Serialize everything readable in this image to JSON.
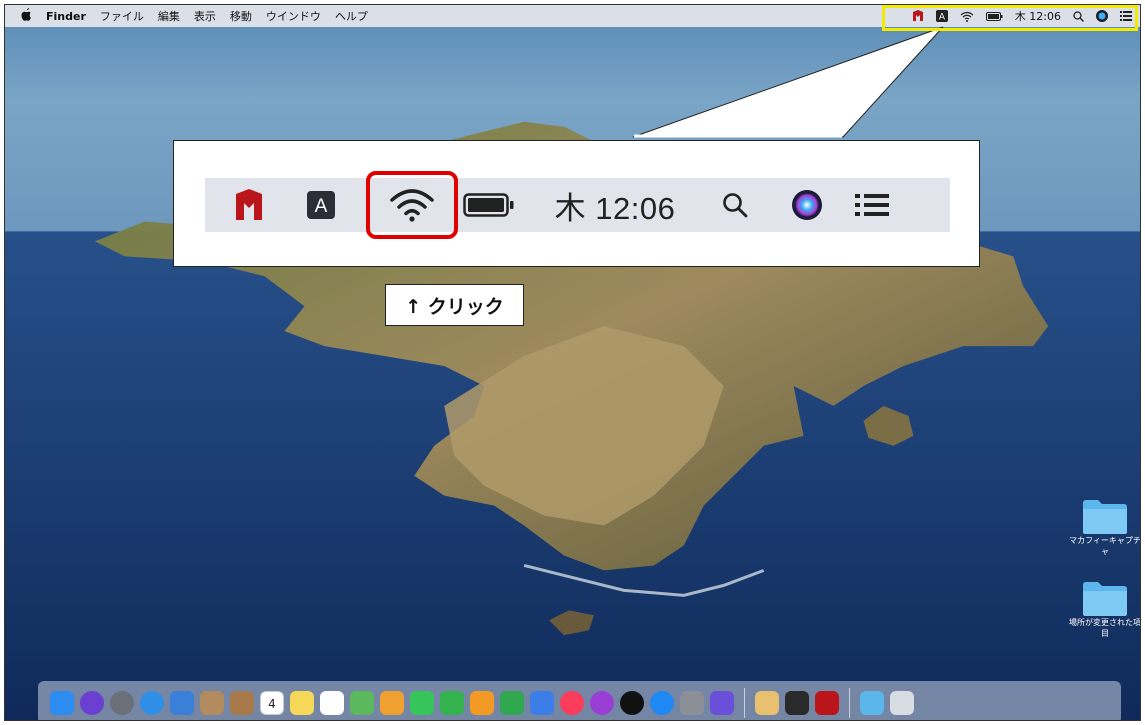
{
  "menubar": {
    "apple_glyph": "",
    "items": [
      "Finder",
      "ファイル",
      "編集",
      "表示",
      "移動",
      "ウインドウ",
      "ヘルプ"
    ],
    "status": {
      "clock": "木 12:06"
    }
  },
  "callout": {
    "clock": "木 12:06",
    "ime_letter": "A"
  },
  "click_label": "↑ クリック",
  "desktop": {
    "folders": [
      {
        "label": "マカフィーキャプチャ"
      },
      {
        "label": "場所が変更された項目"
      }
    ]
  },
  "dock": {
    "items": [
      "finder-icon",
      "siri-icon",
      "launchpad-icon",
      "safari-icon",
      "mail-icon",
      "contacts-icon",
      "notes-book-icon",
      "calendar-icon",
      "notes-icon",
      "reminders-icon",
      "maps-icon",
      "photos-icon",
      "messages-icon",
      "facetime-icon",
      "pages-icon",
      "numbers-icon",
      "keynote-icon",
      "music-icon",
      "podcasts-icon",
      "appletv-icon",
      "appstore-icon",
      "system-preferences-icon",
      "imovie-icon",
      "preview-icon",
      "quicktime-icon",
      "mcafee-icon",
      "downloads-folder-icon",
      "trash-icon"
    ],
    "calendar_day": "4"
  },
  "colors": {
    "highlight": "#f2ea00",
    "ring": "#e00000",
    "mcafee": "#b9151b"
  }
}
